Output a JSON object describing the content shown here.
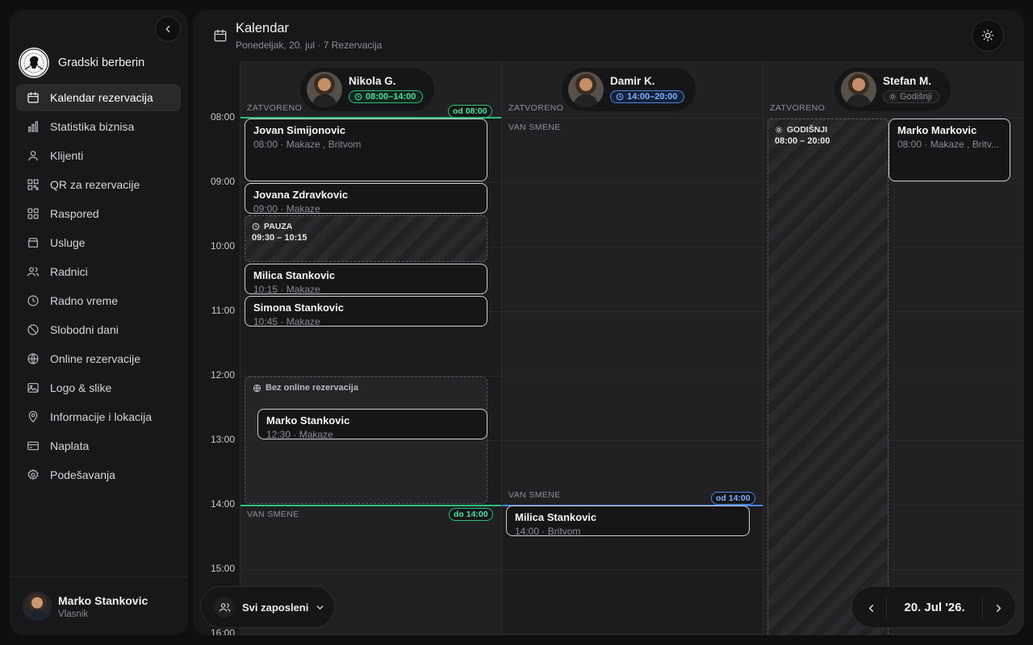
{
  "brand": {
    "name": "Gradski berberin",
    "logo_icon": "barber-logo-icon"
  },
  "nav": [
    {
      "label": "Kalendar rezervacija",
      "icon": "calendar-icon",
      "active": true
    },
    {
      "label": "Statistika biznisa",
      "icon": "bar-chart-icon"
    },
    {
      "label": "Klijenti",
      "icon": "user-icon"
    },
    {
      "label": "QR za rezervacije",
      "icon": "qr-code-icon"
    },
    {
      "label": "Raspored",
      "icon": "grid-icon"
    },
    {
      "label": "Usluge",
      "icon": "box-icon"
    },
    {
      "label": "Radnici",
      "icon": "users-icon"
    },
    {
      "label": "Radno vreme",
      "icon": "clock-icon"
    },
    {
      "label": "Slobodni dani",
      "icon": "ban-icon"
    },
    {
      "label": "Online rezervacije",
      "icon": "globe-icon"
    },
    {
      "label": "Logo & slike",
      "icon": "image-icon"
    },
    {
      "label": "Informacije i lokacija",
      "icon": "map-pin-icon"
    },
    {
      "label": "Naplata",
      "icon": "credit-card-icon"
    },
    {
      "label": "Podešavanja",
      "icon": "gear-icon"
    }
  ],
  "user": {
    "name": "Marko Stankovic",
    "role": "Vlasnik"
  },
  "header": {
    "title": "Kalendar",
    "subtitle": "Ponedeljak, 20. jul · 7 Rezervacija"
  },
  "times": [
    "08:00",
    "09:00",
    "10:00",
    "11:00",
    "12:00",
    "13:00",
    "14:00",
    "15:00",
    "16:00"
  ],
  "labels": {
    "closed": "ZATVORENO",
    "off_shift": "VAN SMENE",
    "break": "PAUZA",
    "vacation": "GODIŠNJI",
    "no_online": "Bez online rezervacija"
  },
  "staff": [
    {
      "name": "Nikola G.",
      "shift": "08:00–14:00",
      "shift_color": "#2fbf7a",
      "from_pill": "od 08:00",
      "to_pill": "do 14:00",
      "break_time": "09:30 – 10:15"
    },
    {
      "name": "Damir K.",
      "shift": "14:00–20:00",
      "shift_color": "#4a86e0",
      "from_pill": "od 14:00"
    },
    {
      "name": "Stefan M.",
      "shift": "Godišnji",
      "vacation_time": "08:00 – 20:00"
    }
  ],
  "appointments": [
    {
      "name": "Jovan Simijonovic",
      "detail": "08:00 · Makaze , Britvom"
    },
    {
      "name": "Jovana Zdravkovic",
      "detail": "09:00 · Makaze"
    },
    {
      "name": "Milica Stankovic",
      "detail": "10:15 · Makaze"
    },
    {
      "name": "Simona Stankovic",
      "detail": "10:45 · Makaze"
    },
    {
      "name": "Marko Stankovic",
      "detail": "12:30 · Makaze"
    },
    {
      "name": "Milica Stankovic",
      "detail": "14:00 · Britvom"
    },
    {
      "name": "Marko Markovic",
      "detail": "08:00 · Makaze , Britv..."
    }
  ],
  "filter": {
    "label": "Svi zaposleni"
  },
  "date_nav": {
    "label": "20. Jul '26."
  }
}
